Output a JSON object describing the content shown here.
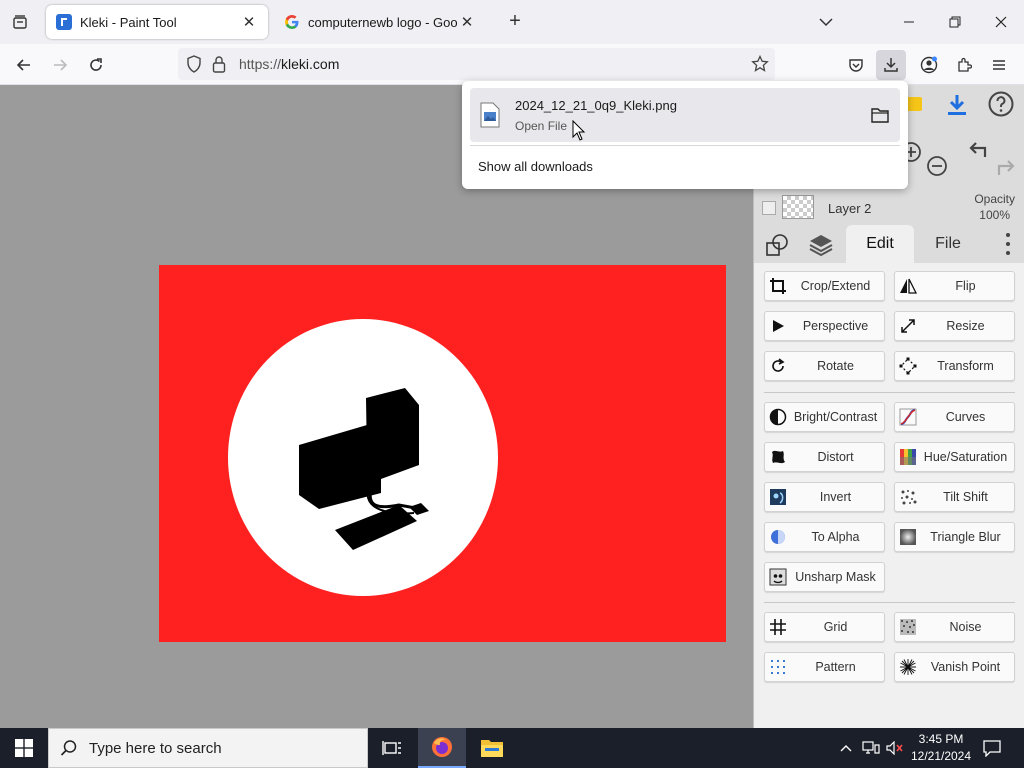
{
  "browser": {
    "tabs": [
      {
        "title": "Kleki - Paint Tool",
        "active": true
      },
      {
        "title": "computernewb logo - Google S",
        "active": false
      }
    ],
    "url": {
      "prefix": "https://",
      "host": "kleki.com"
    }
  },
  "downloads": {
    "items": [
      {
        "filename": "2024_12_21_0q9_Kleki.png",
        "action": "Open File"
      }
    ],
    "show_all": "Show all downloads"
  },
  "layers": {
    "current": "Layer 2",
    "opacity_label": "Opacity",
    "opacity_value": "100%"
  },
  "panel_tabs": {
    "edit": "Edit",
    "file": "File"
  },
  "tools": [
    {
      "label": "Crop/Extend",
      "icon": "crop-icon"
    },
    {
      "label": "Flip",
      "icon": "flip-icon"
    },
    {
      "label": "Perspective",
      "icon": "perspective-icon"
    },
    {
      "label": "Resize",
      "icon": "resize-icon"
    },
    {
      "label": "Rotate",
      "icon": "rotate-icon"
    },
    {
      "label": "Transform",
      "icon": "transform-icon"
    },
    {
      "label": "Bright/Contrast",
      "icon": "brightness-icon"
    },
    {
      "label": "Curves",
      "icon": "curves-icon"
    },
    {
      "label": "Distort",
      "icon": "distort-icon"
    },
    {
      "label": "Hue/Saturation",
      "icon": "hue-saturation-icon"
    },
    {
      "label": "Invert",
      "icon": "invert-icon"
    },
    {
      "label": "Tilt Shift",
      "icon": "tilt-shift-icon"
    },
    {
      "label": "To Alpha",
      "icon": "to-alpha-icon"
    },
    {
      "label": "Triangle Blur",
      "icon": "triangle-blur-icon"
    },
    {
      "label": "Unsharp Mask",
      "icon": "unsharp-mask-icon"
    },
    {
      "label": "Grid",
      "icon": "grid-icon"
    },
    {
      "label": "Noise",
      "icon": "noise-icon"
    },
    {
      "label": "Pattern",
      "icon": "pattern-icon"
    },
    {
      "label": "Vanish Point",
      "icon": "vanish-point-icon"
    }
  ],
  "canvas": {
    "background_color": "#ff2020",
    "circle_color": "#ffffff"
  },
  "taskbar": {
    "search_placeholder": "Type here to search",
    "time": "3:45 PM",
    "date": "12/21/2024"
  }
}
